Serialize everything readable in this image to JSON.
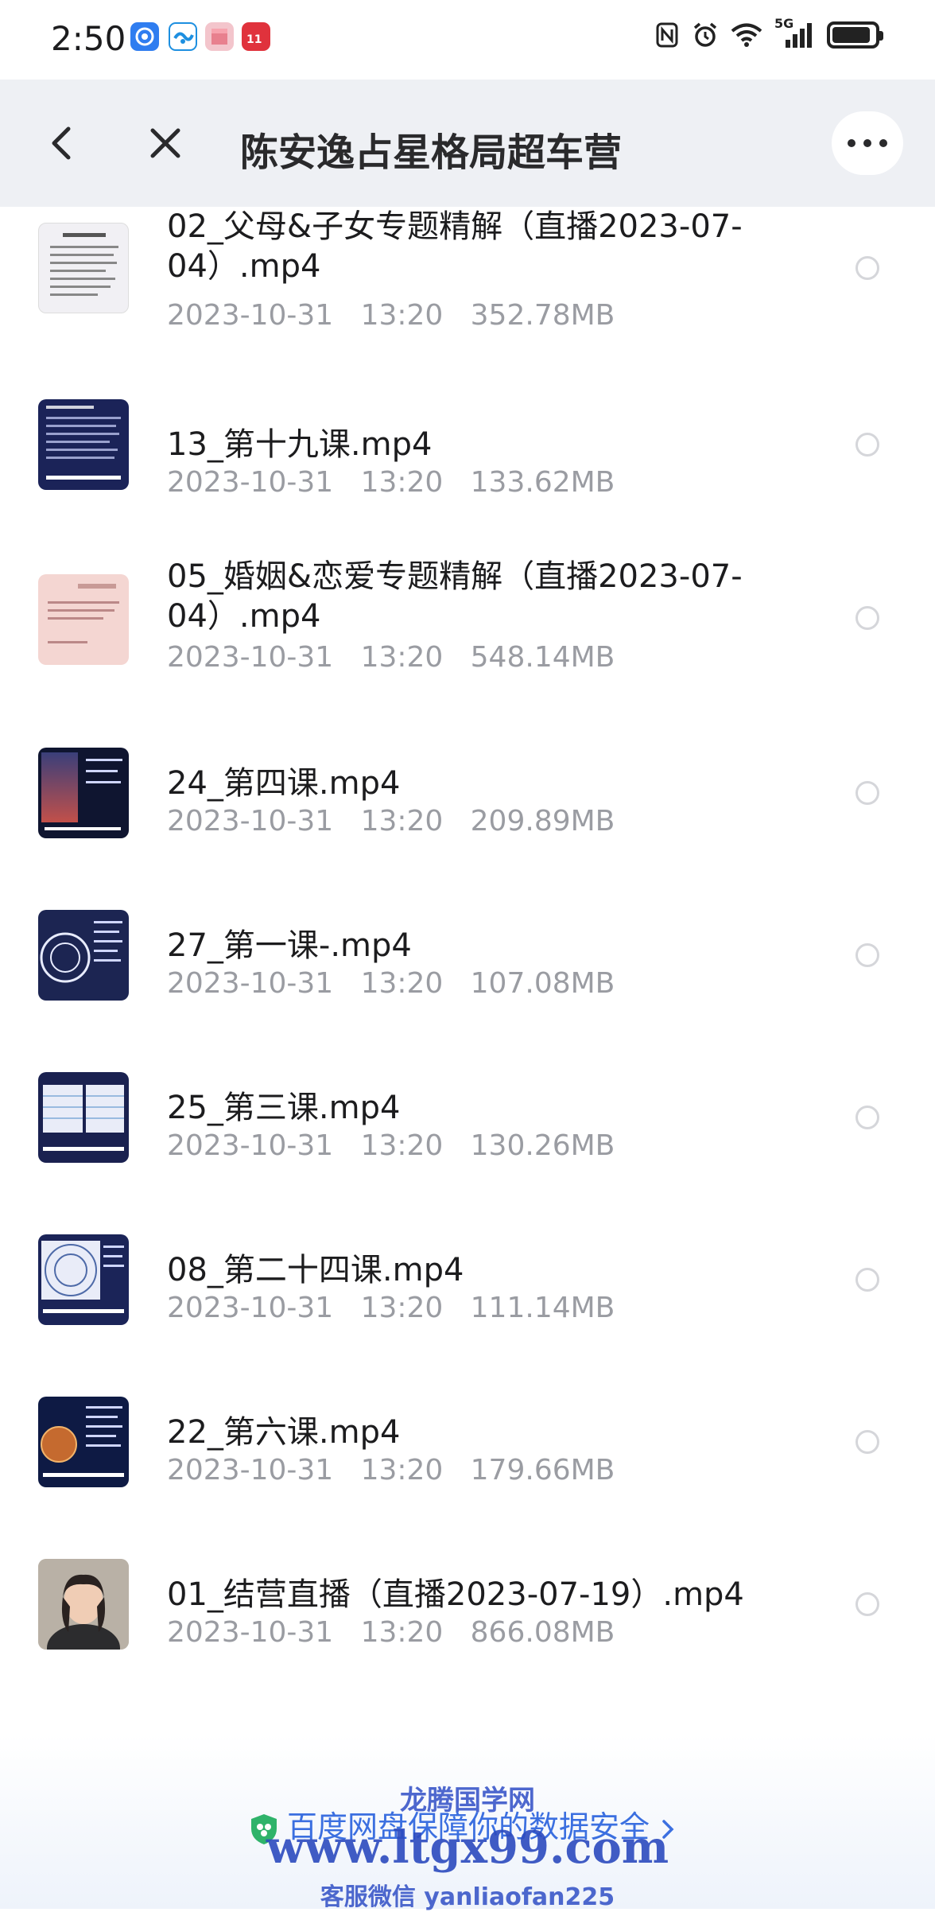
{
  "status_bar": {
    "time": "2:50",
    "app_icons": [
      "app-icon-blue",
      "app-icon-blue-wave",
      "app-icon-pink-box",
      "app-icon-11-11"
    ],
    "right_icons": [
      "nfc-icon",
      "alarm-icon",
      "wifi-icon",
      "signal-5g-icon",
      "battery-icon"
    ],
    "network_label": "5G",
    "battery_level": 0.9
  },
  "navbar": {
    "title": "陈安逸占星格局超车营",
    "icons": [
      "back-icon",
      "close-icon",
      "more-icon"
    ]
  },
  "files": [
    {
      "name": "02_父母&子女专题精解（直播2023-07-04）.mp4",
      "date": "2023-10-31",
      "time": "13:20",
      "size": "352.78MB",
      "thumb": "light-doc"
    },
    {
      "name": "13_第十九课.mp4",
      "date": "2023-10-31",
      "time": "13:20",
      "size": "133.62MB",
      "thumb": "dark-slide"
    },
    {
      "name": "05_婚姻&恋爱专题精解（直播2023-07-04）.mp4",
      "date": "2023-10-31",
      "time": "13:20",
      "size": "548.14MB",
      "thumb": "pink-doc"
    },
    {
      "name": "24_第四课.mp4",
      "date": "2023-10-31",
      "time": "13:20",
      "size": "209.89MB",
      "thumb": "night-slide"
    },
    {
      "name": "27_第一课-.mp4",
      "date": "2023-10-31",
      "time": "13:20",
      "size": "107.08MB",
      "thumb": "chart-slide"
    },
    {
      "name": "25_第三课.mp4",
      "date": "2023-10-31",
      "time": "13:20",
      "size": "130.26MB",
      "thumb": "table-slide"
    },
    {
      "name": "08_第二十四课.mp4",
      "date": "2023-10-31",
      "time": "13:20",
      "size": "111.14MB",
      "thumb": "wheel-slide"
    },
    {
      "name": "22_第六课.mp4",
      "date": "2023-10-31",
      "time": "13:20",
      "size": "179.66MB",
      "thumb": "planet-slide"
    },
    {
      "name": "01_结营直播（直播2023-07-19）.mp4",
      "date": "2023-10-31",
      "time": "13:20",
      "size": "866.08MB",
      "thumb": "person"
    }
  ],
  "footer": {
    "security_text": "百度网盘保障你的数据安全",
    "watermark_top": "龙腾国学网",
    "watermark_url": "www.ltgx99.com",
    "watermark_contact": "客服微信 yanliaofan225"
  },
  "colors": {
    "accent": "#3b6fe0",
    "meta_gray": "#9a9ca2",
    "navbar_bg": "#eef0f4"
  }
}
